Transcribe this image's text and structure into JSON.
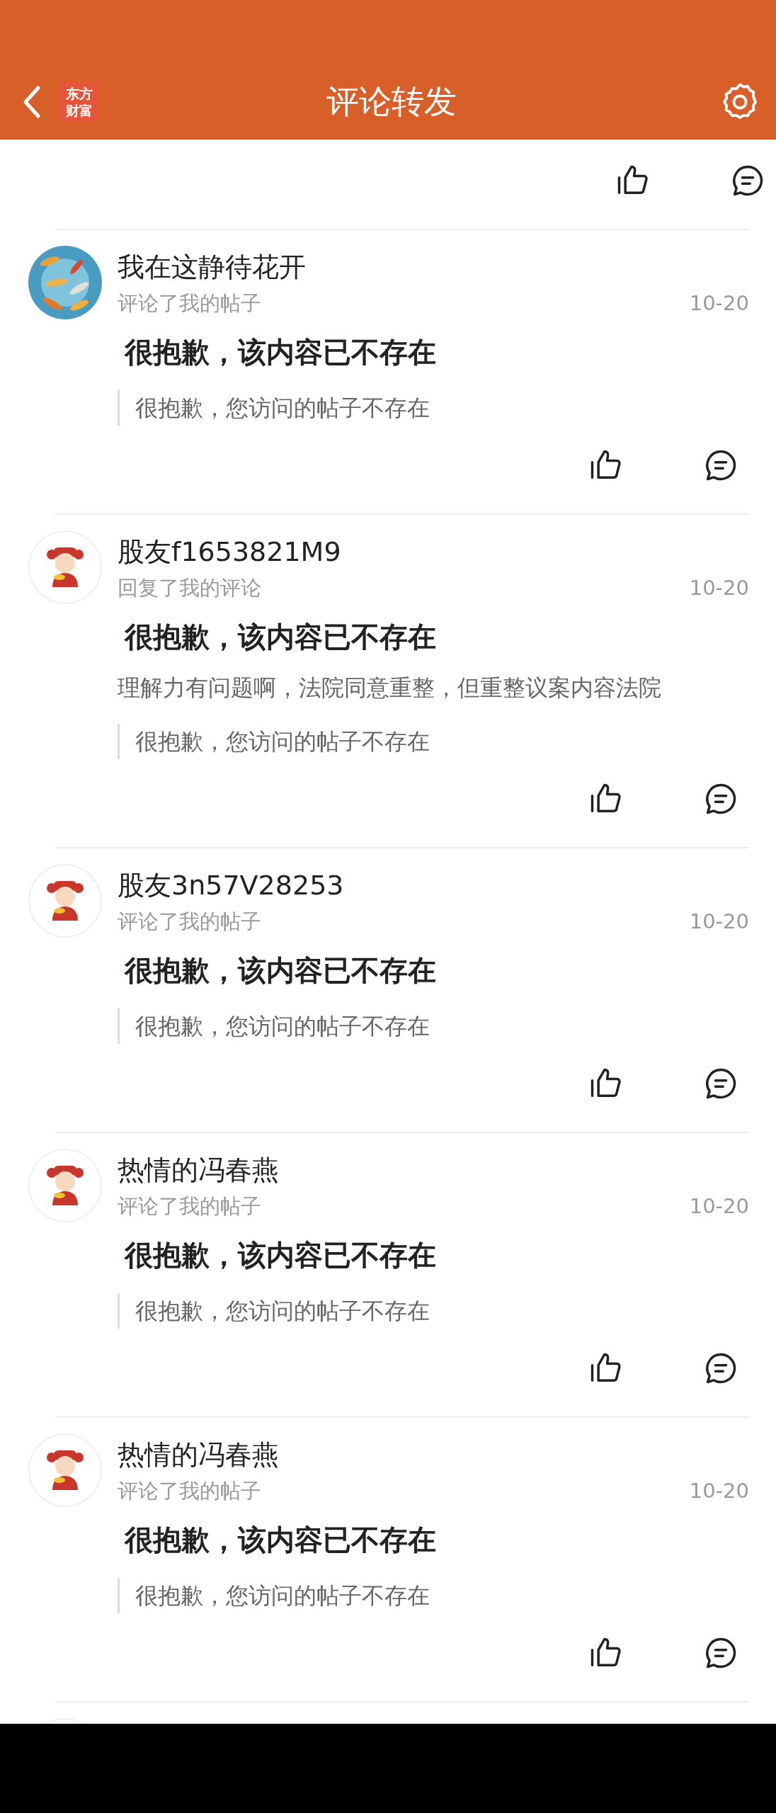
{
  "header": {
    "title": "评论转发",
    "logo": [
      "东方",
      "财富"
    ]
  },
  "items": [
    {
      "kind": "actions"
    },
    {
      "kind": "post",
      "name": "我在这静待花开",
      "action": "评论了我的帖子",
      "date": "10-20",
      "content": "很抱歉，该内容已不存在",
      "quote": "很抱歉，您访问的帖子不存在"
    },
    {
      "kind": "post",
      "avatar": {
        "kind": "figure"
      },
      "name": "股友f1653821M9",
      "action": "回复了我的评论",
      "date": "10-20",
      "content": "很抱歉，该内容已不存在",
      "reply": "理解力有问题啊，法院同意重整，但重整议案内容法院",
      "quote": "很抱歉，您访问的帖子不存在"
    },
    {
      "kind": "post",
      "avatar": {
        "kind": "figure"
      },
      "name": "股友3n57V28253",
      "action": "评论了我的帖子",
      "date": "10-20",
      "content": "很抱歉，该内容已不存在",
      "quote": "很抱歉，您访问的帖子不存在"
    },
    {
      "kind": "post",
      "avatar": {
        "kind": "figure"
      },
      "name": "热情的冯春燕",
      "action": "评论了我的帖子",
      "date": "10-20",
      "content": "很抱歉，该内容已不存在",
      "quote": "很抱歉，您访问的帖子不存在"
    },
    {
      "kind": "post",
      "avatar": {
        "kind": "figure"
      },
      "name": "热情的冯春燕",
      "action": "评论了我的帖子",
      "date": "10-20",
      "content": "很抱歉，该内容已不存在",
      "quote": "很抱歉，您访问的帖子不存在"
    },
    {
      "kind": "cut",
      "avatar": {
        "kind": "figure"
      }
    }
  ]
}
